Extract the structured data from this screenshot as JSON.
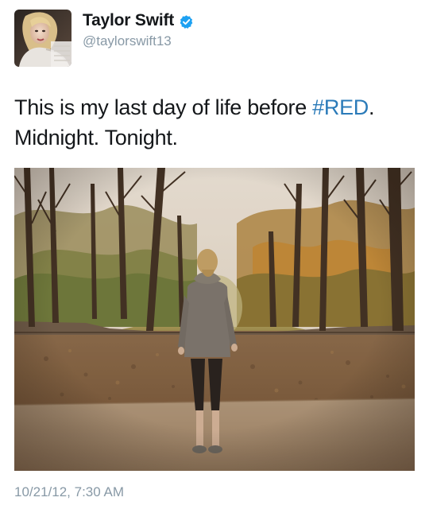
{
  "tweet": {
    "author": {
      "display_name": "Taylor Swift",
      "handle": "@taylorswift13",
      "verified": true,
      "avatar_icon": "profile-photo"
    },
    "text": {
      "line1_prefix": "This is my last day of life before ",
      "hashtag": "#RED",
      "line1_suffix": ".",
      "line2": "Midnight. Tonight."
    },
    "photo": {
      "subject": "woman-standing-in-autumn-park"
    },
    "timestamp": "10/21/12, 7:30 AM"
  },
  "colors": {
    "text_primary": "#14171a",
    "text_secondary": "#8899a6",
    "hashtag_link": "#2b7bb9",
    "verified_badge": "#1da1f2"
  }
}
